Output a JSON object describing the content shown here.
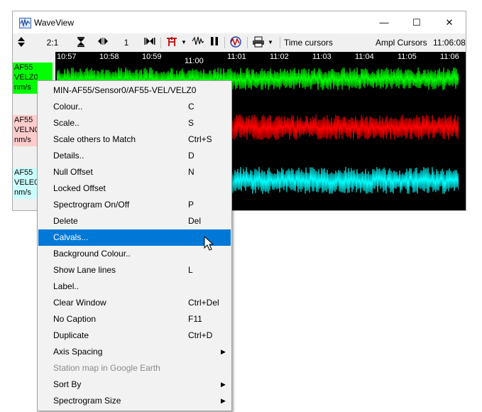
{
  "window": {
    "title": "WaveView",
    "minimize_glyph": "—",
    "maximize_glyph": "☐",
    "close_glyph": "✕"
  },
  "toolbar": {
    "ratio": "2:1",
    "scale": "1",
    "time_cursors": "Time cursors",
    "ampl_cursors": "Ampl Cursors",
    "clock": "11:06:08"
  },
  "time_axis": {
    "ticks": [
      "10:57",
      "10:58",
      "10:59",
      "11:00",
      "11:01",
      "11:02",
      "11:03",
      "11:04",
      "11:05",
      "11:06"
    ]
  },
  "channels": [
    {
      "station": "AF55",
      "component": "VELZ0",
      "units": "nm/s",
      "color": "#00ff00"
    },
    {
      "station": "AF55",
      "component": "VELN0",
      "units": "nm/s",
      "color": "#ff0000"
    },
    {
      "station": "AF55",
      "component": "VELE0",
      "units": "nm/s",
      "color": "#00ffff"
    }
  ],
  "context_menu": {
    "header": "MIN-AF55/Sensor0/AF55-VEL/VELZ0",
    "items": [
      {
        "label": "Colour..",
        "shortcut": "C"
      },
      {
        "label": "Scale..",
        "shortcut": "S"
      },
      {
        "label": "Scale others to Match",
        "shortcut": "Ctrl+S"
      },
      {
        "label": "Details..",
        "shortcut": "D"
      },
      {
        "label": "Null Offset",
        "shortcut": "N"
      },
      {
        "label": "Locked Offset",
        "shortcut": ""
      },
      {
        "label": "Spectrogram On/Off",
        "shortcut": "P"
      },
      {
        "label": "Delete",
        "shortcut": "Del"
      },
      {
        "label": "Calvals...",
        "shortcut": "",
        "highlighted": true
      },
      {
        "label": "Background Colour..",
        "shortcut": ""
      },
      {
        "label": "Show Lane lines",
        "shortcut": "L"
      },
      {
        "label": "Label..",
        "shortcut": ""
      },
      {
        "label": "Clear Window",
        "shortcut": "Ctrl+Del"
      },
      {
        "label": "No Caption",
        "shortcut": "F11"
      },
      {
        "label": "Duplicate",
        "shortcut": "Ctrl+D"
      },
      {
        "label": "Axis Spacing",
        "shortcut": "",
        "submenu": true
      },
      {
        "label": "Station map in Google Earth",
        "shortcut": "",
        "disabled": true
      },
      {
        "label": "Sort By",
        "shortcut": "",
        "submenu": true
      },
      {
        "label": "Spectrogram Size",
        "shortcut": "",
        "submenu": true
      }
    ]
  }
}
